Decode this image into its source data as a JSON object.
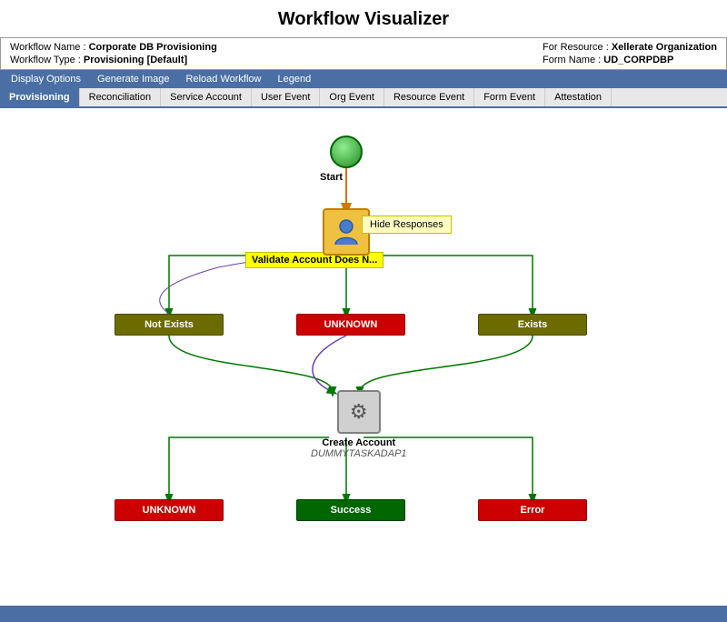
{
  "title": "Workflow Visualizer",
  "info": {
    "workflow_name_label": "Workflow Name :",
    "workflow_name_value": "Corporate DB Provisioning",
    "workflow_type_label": "Workflow Type :",
    "workflow_type_value": "Provisioning [Default]",
    "for_resource_label": "For Resource :",
    "for_resource_value": "Xellerate Organization",
    "form_name_label": "Form Name :",
    "form_name_value": "UD_CORPDBP"
  },
  "menu": {
    "items": [
      {
        "id": "display-options",
        "label": "Display Options"
      },
      {
        "id": "generate-image",
        "label": "Generate Image"
      },
      {
        "id": "reload-workflow",
        "label": "Reload Workflow"
      },
      {
        "id": "legend",
        "label": "Legend"
      }
    ]
  },
  "tabs": [
    {
      "id": "provisioning",
      "label": "Provisioning",
      "active": true
    },
    {
      "id": "reconciliation",
      "label": "Reconciliation",
      "active": false
    },
    {
      "id": "service-account",
      "label": "Service Account",
      "active": false
    },
    {
      "id": "user-event",
      "label": "User Event",
      "active": false
    },
    {
      "id": "org-event",
      "label": "Org Event",
      "active": false
    },
    {
      "id": "resource-event",
      "label": "Resource Event",
      "active": false
    },
    {
      "id": "form-event",
      "label": "Form Event",
      "active": false
    },
    {
      "id": "attestation",
      "label": "Attestation",
      "active": false
    }
  ],
  "workflow": {
    "start_label": "Start",
    "validate_label": "Validate Account Does N...",
    "tooltip_label": "Hide Responses",
    "create_label": "Create Account",
    "create_sublabel": "DUMMYTASKADAP1",
    "boxes": {
      "not_exists": "Not Exists",
      "unknown1": "UNKNOWN",
      "exists": "Exists",
      "unknown2": "UNKNOWN",
      "success": "Success",
      "error": "Error"
    }
  }
}
